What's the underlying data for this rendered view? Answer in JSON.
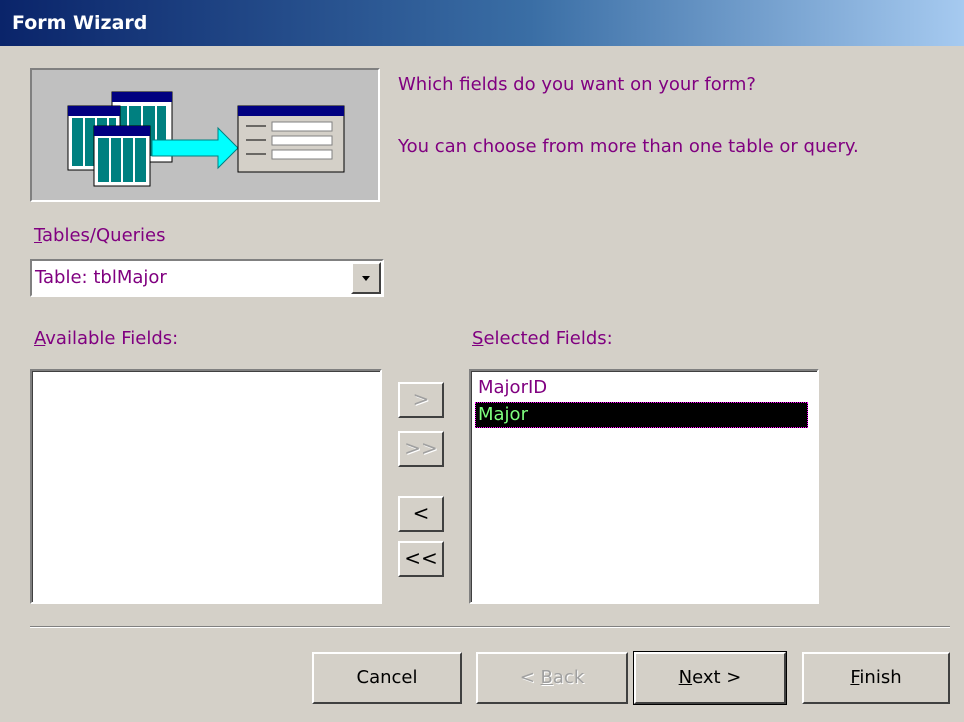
{
  "window": {
    "title": "Form Wizard"
  },
  "prompt": {
    "line1": "Which fields do you want on your form?",
    "line2": "You can choose from more than one table or query."
  },
  "tables_queries": {
    "label_first": "T",
    "label_rest": "ables/Queries",
    "value": "Table: tblMajor"
  },
  "available_fields": {
    "label_first": "A",
    "label_rest": "vailable Fields:",
    "items": []
  },
  "selected_fields": {
    "label_first": "S",
    "label_rest": "elected Fields:",
    "items": [
      "MajorID",
      "Major"
    ],
    "selected_index": 1
  },
  "move_buttons": {
    "add_one": ">",
    "add_all": ">>",
    "remove_one": "<",
    "remove_all": "<<"
  },
  "buttons": {
    "cancel": "Cancel",
    "back_prefix": "< ",
    "back_first": "B",
    "back_rest": "ack",
    "next_first": "N",
    "next_rest": "ext >",
    "finish_first": "F",
    "finish_rest": "inish"
  },
  "colors": {
    "title_start": "#0a246a",
    "title_end": "#a6caf0",
    "label_text": "#800080",
    "selection_text": "#7fff7f"
  }
}
